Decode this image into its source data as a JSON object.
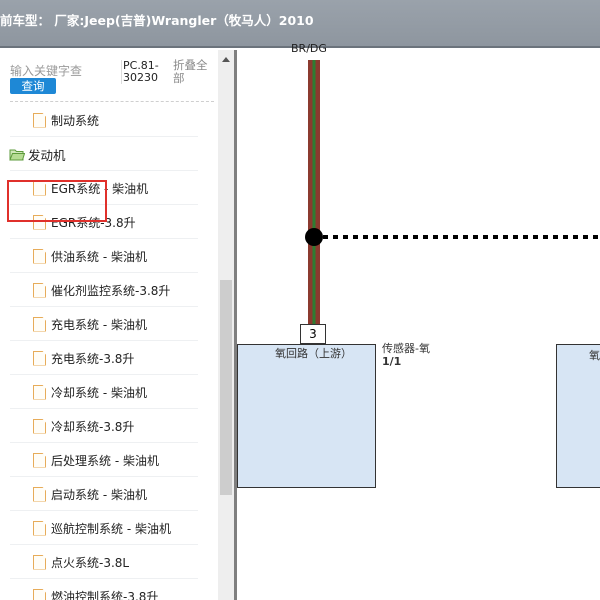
{
  "header": {
    "title": "前车型：  厂家:Jeep(吉普)Wrangler（牧马人）2010"
  },
  "search": {
    "placeholder": "输入关键字查",
    "button_label": "查询",
    "code": "PC.81-30230",
    "collapse_label": "折叠全部"
  },
  "tree": {
    "items": [
      {
        "label": "制动系统",
        "type": "doc"
      },
      {
        "label": "发动机",
        "type": "folder"
      },
      {
        "label": "EGR系统 - 柴油机",
        "type": "doc"
      },
      {
        "label": "EGR系统-3.8升",
        "type": "doc"
      },
      {
        "label": "供油系统 - 柴油机",
        "type": "doc"
      },
      {
        "label": "催化剂监控系统-3.8升",
        "type": "doc"
      },
      {
        "label": "充电系统 - 柴油机",
        "type": "doc"
      },
      {
        "label": "充电系统-3.8升",
        "type": "doc"
      },
      {
        "label": "冷却系统 - 柴油机",
        "type": "doc"
      },
      {
        "label": "冷却系统-3.8升",
        "type": "doc"
      },
      {
        "label": "后处理系统 - 柴油机",
        "type": "doc"
      },
      {
        "label": "启动系统 - 柴油机",
        "type": "doc"
      },
      {
        "label": "巡航控制系统 - 柴油机",
        "type": "doc"
      },
      {
        "label": "点火系统-3.8L",
        "type": "doc"
      },
      {
        "label": "燃油控制系统-3.8升",
        "type": "doc"
      }
    ]
  },
  "diagram": {
    "wire_code": "BR/DG",
    "pin_number": "3",
    "box_label": "氧回路（上游）",
    "sensor_label": "传感器-氧",
    "sensor_number": "1/1",
    "right_box_label": "氧"
  },
  "colors": {
    "accent": "#1e88d6",
    "highlight": "#e0302b",
    "wire_brown": "#8b3a2f",
    "wire_green": "#2e7d32",
    "box_fill": "#d7e5f4"
  }
}
